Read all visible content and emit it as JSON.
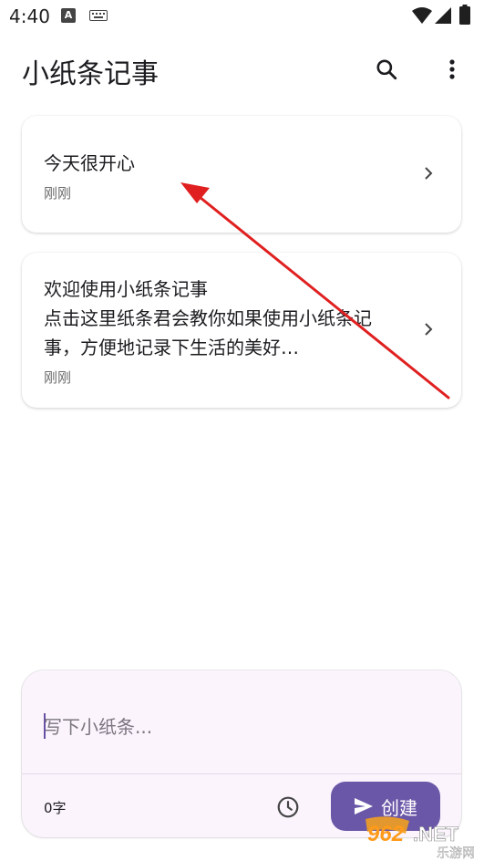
{
  "status_bar": {
    "time": "4:40",
    "a_icon": "A"
  },
  "app_bar": {
    "title": "小纸条记事",
    "search_icon": "search-icon",
    "more_icon": "more-vert-icon"
  },
  "notes": [
    {
      "text": "今天很开心",
      "time": "刚刚"
    },
    {
      "text": "欢迎使用小纸条记事\n点击这里纸条君会教你如果使用小纸条记事，方便地记录下生活的美好…",
      "time": "刚刚"
    }
  ],
  "composer": {
    "placeholder": "写下小纸条...",
    "char_count": "0字",
    "create_label": "创建"
  },
  "watermark": {
    "brand": "962",
    "suffix": ".NET",
    "sub": "乐游网"
  },
  "colors": {
    "accent": "#6b57a8",
    "annotation_arrow": "#e02020",
    "composer_bg": "#fbf4fd"
  }
}
